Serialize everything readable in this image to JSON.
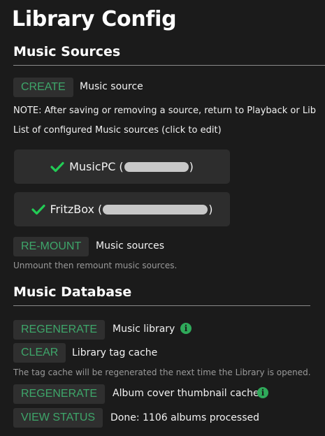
{
  "page_title": "Library Config",
  "music_sources": {
    "heading": "Music Sources",
    "create_button": "CREATE",
    "create_label": "Music source",
    "note": "NOTE: After saving or removing a source, return to Playback or Lib",
    "list_caption": "List of configured Music sources (click to edit)",
    "sources": [
      {
        "name": "MusicPC",
        "open": "(",
        "close": ")"
      },
      {
        "name": "FritzBox",
        "open": "(",
        "close": ")"
      }
    ],
    "remount_button": "RE-MOUNT",
    "remount_label": "Music sources",
    "remount_hint": "Unmount then remount music sources."
  },
  "music_database": {
    "heading": "Music Database",
    "regen_library_button": "REGENERATE",
    "regen_library_label": "Music library",
    "clear_button": "CLEAR",
    "clear_label": "Library tag cache",
    "clear_hint": "The tag cache will be regenerated the next time the Library is opened.",
    "regen_thumbs_button": "REGENERATE",
    "regen_thumbs_label": "Album cover thumbnail cache",
    "view_status_button": "VIEW STATUS",
    "status_text": "Done: 1106 albums processed"
  },
  "colors": {
    "accent_green": "#3ea66a",
    "check_green": "#22cc55",
    "background": "#1b1b1b"
  },
  "icons": {
    "source_ok": "checkmark-icon",
    "info": "info-icon"
  }
}
